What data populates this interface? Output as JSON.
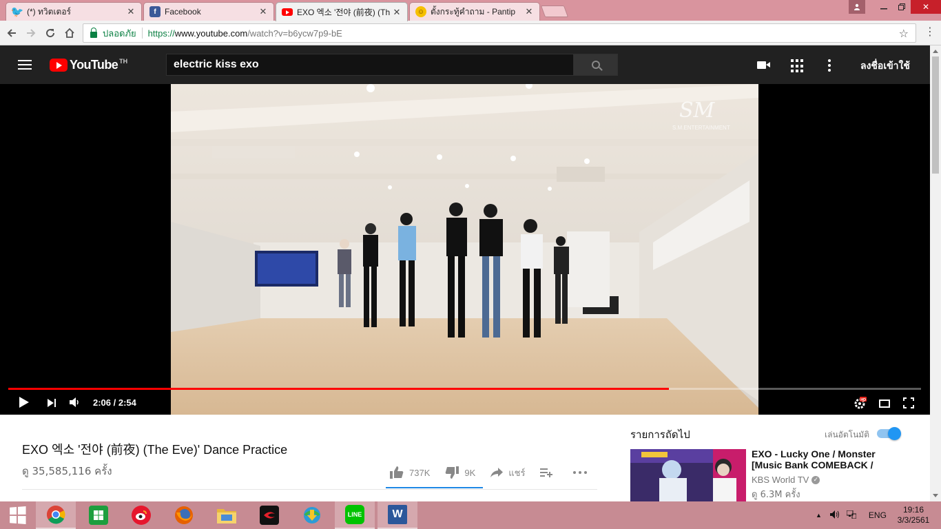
{
  "browser": {
    "tabs": [
      {
        "title": "(*) ทวิตเตอร์",
        "icon": "twitter-icon",
        "color": "#1da1f2",
        "active": false
      },
      {
        "title": "Facebook",
        "icon": "facebook-icon",
        "color": "#3b5998",
        "active": false
      },
      {
        "title": "EXO 엑소 '전야 (前夜) (Th",
        "icon": "youtube-icon",
        "color": "#ff0000",
        "active": true
      },
      {
        "title": "ตั้งกระทู้คำถาม - Pantip",
        "icon": "pantip-icon",
        "color": "#f6c000",
        "active": false
      }
    ],
    "secure_label": "ปลอดภัย",
    "url_scheme": "https://",
    "url_host": "www.youtube.com",
    "url_path": "/watch?v=b6ycw7p9-bE"
  },
  "youtube": {
    "logo_text": "YouTube",
    "region": "TH",
    "search_value": "electric kiss exo",
    "signin_label": "ลงชื่อเข้าใช้"
  },
  "player": {
    "time_display": "2:06 / 2:54",
    "progress_fraction": 0.724,
    "watermark_logo": "SM",
    "watermark_text": "S.M.ENTERTAINMENT"
  },
  "video": {
    "title": "EXO 엑소 '전야 (前夜) (The Eve)' Dance Practice",
    "views": "ดู 35,585,116 ครั้ง",
    "likes": "737K",
    "dislikes": "9K",
    "share_label": "แชร์"
  },
  "sidebar": {
    "up_next_label": "รายการถัดไป",
    "autoplay_label": "เล่นอัตโนมัติ",
    "autoplay_on": true,
    "recommendations": [
      {
        "title": "EXO - Lucky One / Monster [Music Bank COMEBACK /",
        "channel": "KBS World TV",
        "views": "ดู 6.3M ครั้ง"
      }
    ]
  },
  "taskbar": {
    "apps": [
      "chrome-icon",
      "store-icon",
      "weibo-icon",
      "firefox-icon",
      "file-explorer-icon",
      "garena-icon",
      "download-manager-icon",
      "line-icon",
      "word-icon"
    ],
    "line_label": "LINE",
    "language": "ENG",
    "time": "19:16",
    "date": "3/3/2561"
  },
  "colors": {
    "accent_red": "#ff0000",
    "header_bg": "#212121",
    "taskbar_bg": "#c78b93",
    "tabstrip_bg": "#d9949e",
    "link_blue": "#1e88e5"
  }
}
